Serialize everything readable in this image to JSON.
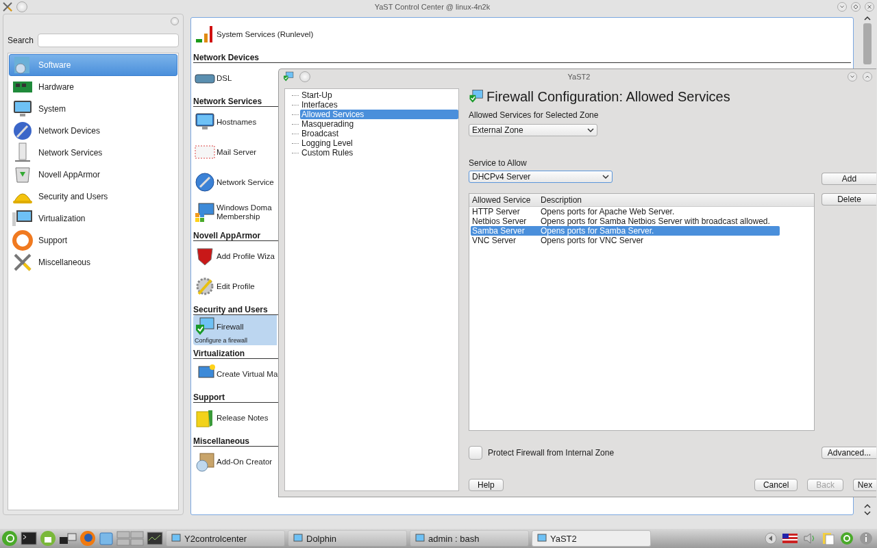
{
  "window": {
    "title": "YaST Control Center @ linux-4n2k"
  },
  "sidebar": {
    "search_label": "Search",
    "categories": [
      {
        "label": "Software",
        "selected": true
      },
      {
        "label": "Hardware",
        "selected": false
      },
      {
        "label": "System",
        "selected": false
      },
      {
        "label": "Network Devices",
        "selected": false
      },
      {
        "label": "Network Services",
        "selected": false
      },
      {
        "label": "Novell AppArmor",
        "selected": false
      },
      {
        "label": "Security and Users",
        "selected": false
      },
      {
        "label": "Virtualization",
        "selected": false
      },
      {
        "label": "Support",
        "selected": false
      },
      {
        "label": "Miscellaneous",
        "selected": false
      }
    ]
  },
  "modules": [
    {
      "items": [
        {
          "label": "System Services (Runlevel)",
          "selected": false
        }
      ]
    },
    {
      "heading": "Network Devices",
      "items": [
        {
          "label": "DSL",
          "selected": false
        }
      ]
    },
    {
      "heading": "Network Services",
      "items": [
        {
          "label": "Hostnames",
          "selected": false
        },
        {
          "label": "Mail Server",
          "selected": false
        },
        {
          "label": "Network Service",
          "selected": false
        },
        {
          "label": "Windows Doma\nMembership",
          "selected": false
        }
      ]
    },
    {
      "heading": "Novell AppArmor",
      "items": [
        {
          "label": "Add Profile Wiza",
          "selected": false
        },
        {
          "label": "Edit Profile",
          "selected": false
        }
      ]
    },
    {
      "heading": "Security and Users",
      "items": [
        {
          "label": "Firewall",
          "description": "Configure a firewall",
          "selected": true
        }
      ]
    },
    {
      "heading": "Virtualization",
      "items": [
        {
          "label": "Create Virtual Ma",
          "selected": false
        }
      ]
    },
    {
      "heading": "Support",
      "items": [
        {
          "label": "Release Notes",
          "selected": false
        }
      ]
    },
    {
      "heading": "Miscellaneous",
      "items": [
        {
          "label": "Add-On Creator",
          "selected": false
        }
      ]
    }
  ],
  "dialog": {
    "title": "YaST2",
    "steps": [
      {
        "label": "Start-Up",
        "selected": false
      },
      {
        "label": "Interfaces",
        "selected": false
      },
      {
        "label": "Allowed Services",
        "selected": true
      },
      {
        "label": "Masquerading",
        "selected": false
      },
      {
        "label": "Broadcast",
        "selected": false
      },
      {
        "label": "Logging Level",
        "selected": false
      },
      {
        "label": "Custom Rules",
        "selected": false
      }
    ],
    "heading": "Firewall Configuration: Allowed Services",
    "zone_label": "Allowed Services for Selected Zone",
    "zone_value": "External Zone",
    "service_label": "Service to Allow",
    "service_value": "DHCPv4 Server",
    "side_buttons": [
      "Add",
      "Delete"
    ],
    "table": {
      "columns": [
        "Allowed Service",
        "Description"
      ],
      "rows": [
        {
          "cells": [
            "HTTP Server",
            "Opens ports for Apache Web Server."
          ],
          "selected": false
        },
        {
          "cells": [
            "Netbios Server",
            "Opens ports for Samba Netbios Server with broadcast allowed."
          ],
          "selected": false
        },
        {
          "cells": [
            "Samba Server",
            "Opens ports for Samba Server."
          ],
          "selected": true
        },
        {
          "cells": [
            "VNC Server",
            "Opens ports for VNC Server"
          ],
          "selected": false
        }
      ]
    },
    "protect": {
      "label": "Protect Firewall from Internal Zone",
      "checked": false
    },
    "advanced": "Advanced...",
    "help": "Help",
    "footer": [
      {
        "label": "Cancel",
        "disabled": false
      },
      {
        "label": "Back",
        "disabled": true
      },
      {
        "label": "Nex",
        "disabled": false
      }
    ]
  },
  "taskbar": {
    "tasks": [
      {
        "label": "Y2controlcenter",
        "selected": false
      },
      {
        "label": "Dolphin",
        "selected": false
      },
      {
        "label": "admin : bash",
        "selected": false
      },
      {
        "label": "YaST2",
        "selected": true
      }
    ]
  }
}
